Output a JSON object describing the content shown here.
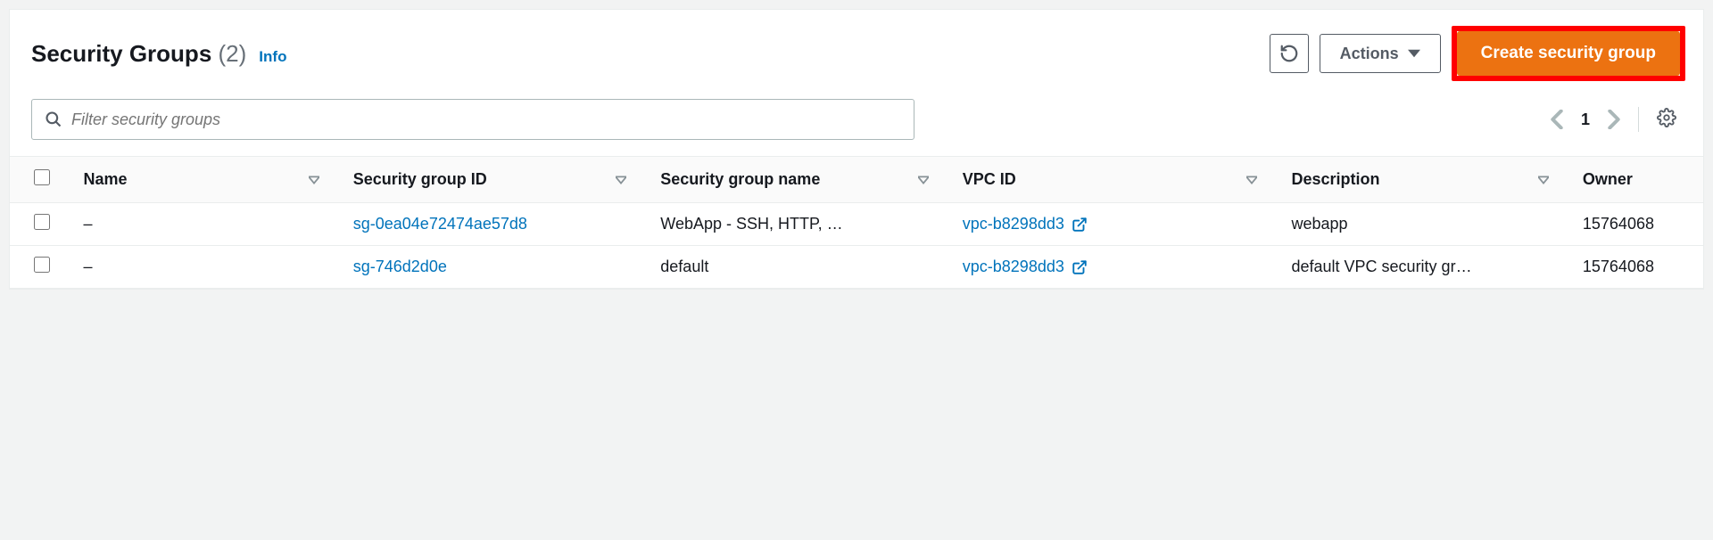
{
  "header": {
    "title": "Security Groups",
    "count": "(2)",
    "info_label": "Info",
    "actions_label": "Actions",
    "create_label": "Create security group"
  },
  "filter": {
    "placeholder": "Filter security groups"
  },
  "pager": {
    "page": "1"
  },
  "columns": {
    "name": "Name",
    "sgid": "Security group ID",
    "sgname": "Security group name",
    "vpc": "VPC ID",
    "desc": "Description",
    "owner": "Owner"
  },
  "rows": [
    {
      "name": "–",
      "sgid": "sg-0ea04e72474ae57d8",
      "sgname": "WebApp - SSH, HTTP, …",
      "vpc": "vpc-b8298dd3",
      "desc": "webapp",
      "owner": "15764068"
    },
    {
      "name": "–",
      "sgid": "sg-746d2d0e",
      "sgname": "default",
      "vpc": "vpc-b8298dd3",
      "desc": "default VPC security gr…",
      "owner": "15764068"
    }
  ]
}
